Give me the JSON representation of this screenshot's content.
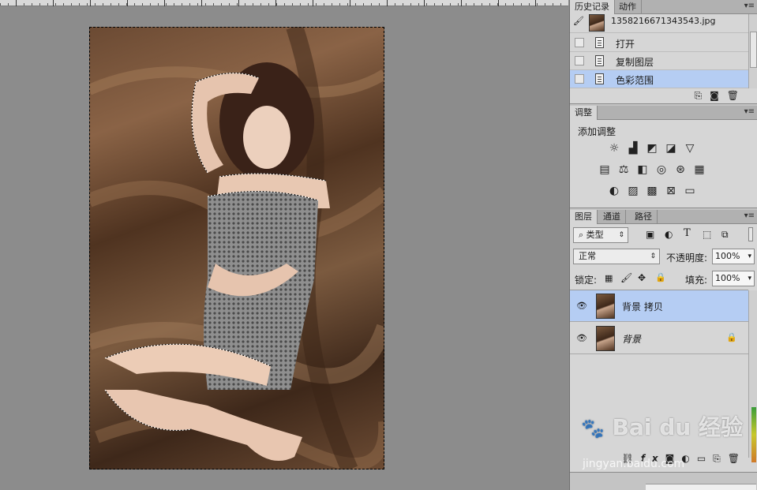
{
  "history_panel": {
    "tabs": [
      "历史记录",
      "动作"
    ],
    "snapshot_name": "1358216671343543.jpg",
    "items": [
      {
        "label": "打开"
      },
      {
        "label": "复制图层"
      },
      {
        "label": "色彩范围",
        "selected": true
      }
    ]
  },
  "adjustments_panel": {
    "tab": "调整",
    "title": "添加调整",
    "row1_icons": [
      "brightness-icon",
      "levels-icon",
      "curves-icon",
      "exposure-icon",
      "vibrance-icon"
    ],
    "row2_icons": [
      "hue-saturation-icon",
      "color-balance-icon",
      "black-white-icon",
      "photo-filter-icon",
      "channel-mixer-icon",
      "color-lookup-icon"
    ],
    "row3_icons": [
      "invert-icon",
      "posterize-icon",
      "threshold-icon",
      "selective-color-icon",
      "gradient-map-icon"
    ]
  },
  "layers_panel": {
    "tabs": [
      "图层",
      "通道",
      "路径"
    ],
    "filter_label": "类型",
    "blend_mode": "正常",
    "opacity_label": "不透明度:",
    "opacity_value": "100%",
    "lock_label": "锁定:",
    "fill_label": "填充:",
    "fill_value": "100%",
    "layers": [
      {
        "name": "背景 拷贝",
        "selected": true,
        "locked": false
      },
      {
        "name": "背景",
        "selected": false,
        "locked": true
      }
    ]
  },
  "watermark": {
    "brand": "Bai du 经验",
    "url": "jingyan.baidu.com"
  }
}
